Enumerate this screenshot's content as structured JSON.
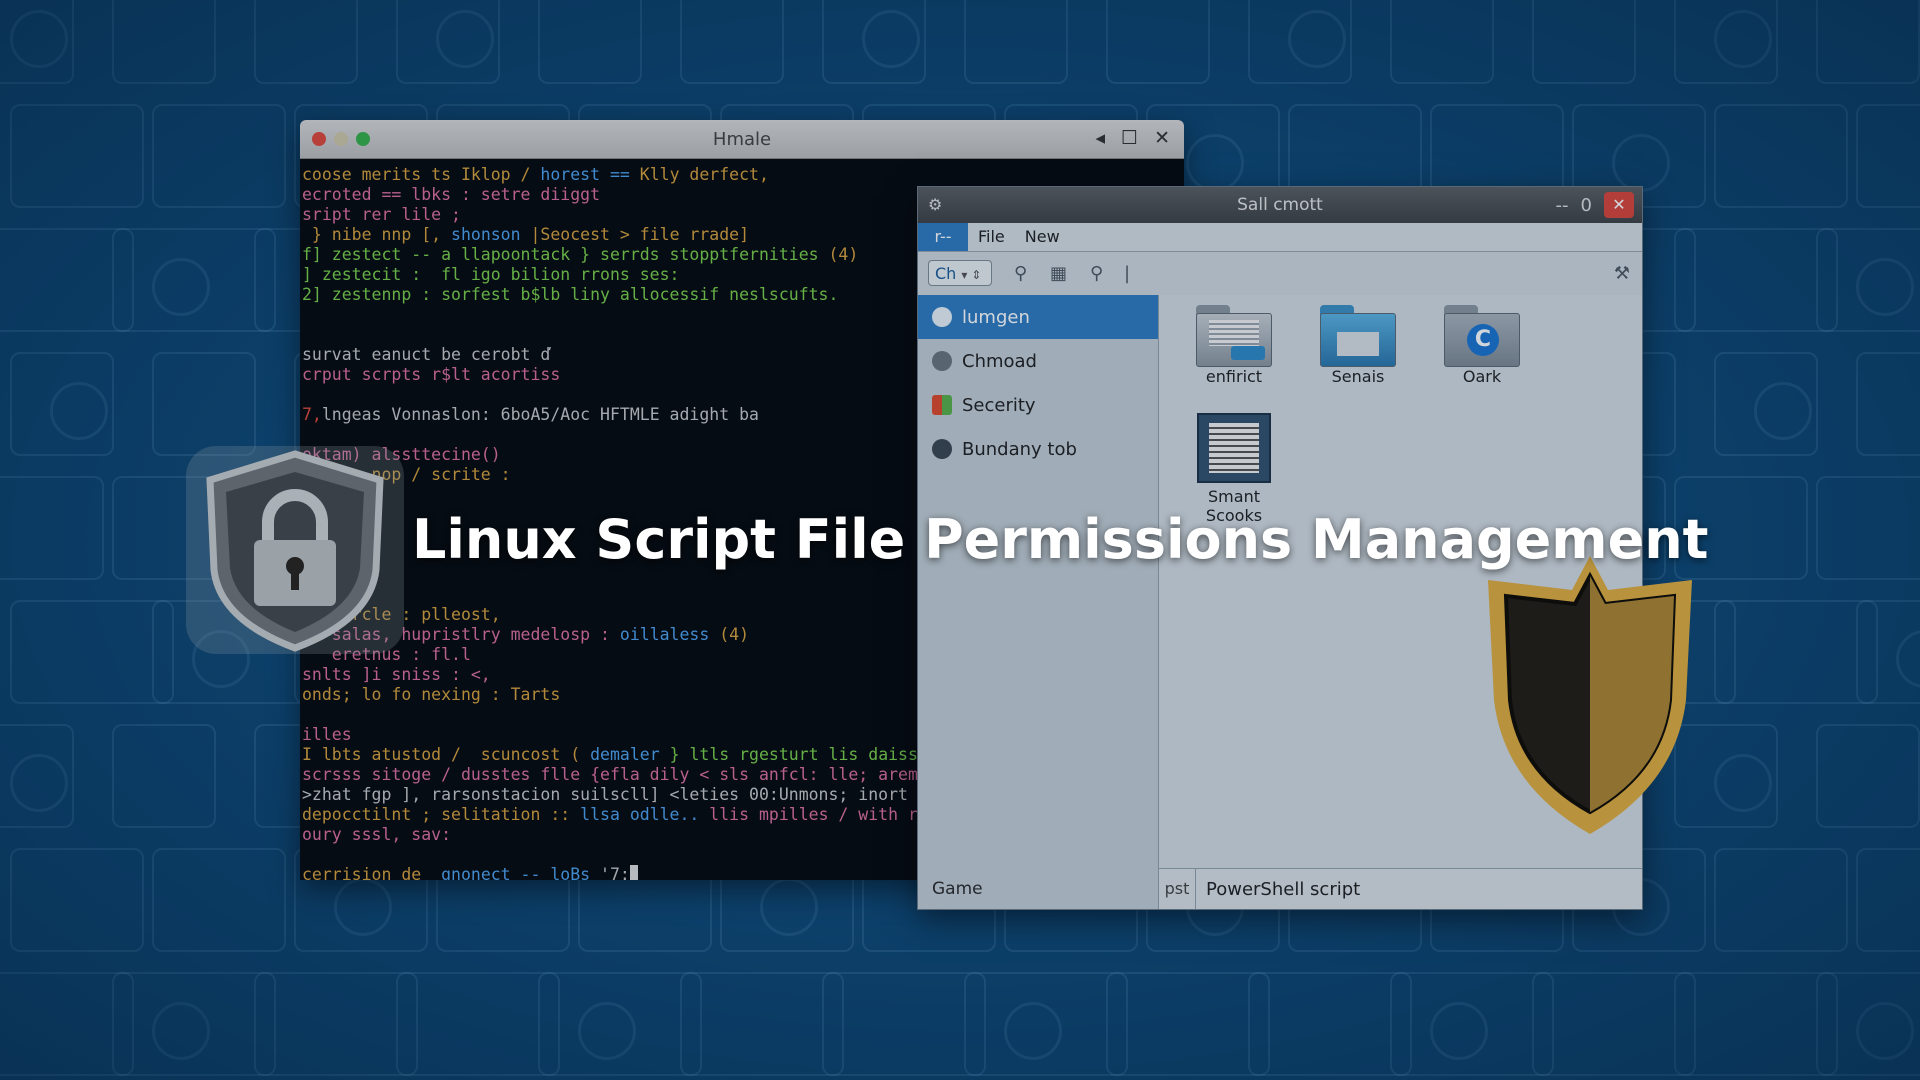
{
  "terminal": {
    "title": "Hmale",
    "lines": [
      [
        {
          "t": "coose merits ts Iklop / ",
          "c": "c-yel"
        },
        {
          "t": "horest == ",
          "c": "c-blu"
        },
        {
          "t": "Klly derfect,",
          "c": "c-yel"
        }
      ],
      [
        {
          "t": "ecroted == lbks : setre diiggt",
          "c": "c-pnk"
        }
      ],
      [
        {
          "t": "sript rer lile ;",
          "c": "c-pnk"
        }
      ],
      [
        {
          "t": " } nibe nnp [, ",
          "c": "c-yel"
        },
        {
          "t": "shonson ",
          "c": "c-blu"
        },
        {
          "t": "|Seocest > file rrade]",
          "c": "c-yel"
        }
      ],
      [
        {
          "t": "f] zestect -- a llapoontack } serrds stopptfernities ",
          "c": "c-grn"
        },
        {
          "t": "(4)",
          "c": "c-yel"
        }
      ],
      [
        {
          "t": "] zestecit :  fl igo bilion rrons ses:",
          "c": "c-grn"
        }
      ],
      [
        {
          "t": "2] zestennp : sorfest b$lb liny allocessif neslscufts.",
          "c": "c-grn"
        }
      ],
      [],
      [],
      [
        {
          "t": "survat eanuct be cerobt ď",
          "c": "c-wht"
        }
      ],
      [
        {
          "t": "crput scrpts r$lt acortiss",
          "c": "c-pnk"
        }
      ],
      [],
      [
        {
          "t": "7,",
          "c": "c-red"
        },
        {
          "t": "lngeas Vonnaslon: 6boA5/Aoc HFTMLE adight ba",
          "c": "c-wht"
        }
      ],
      [],
      [
        {
          "t": "oktam) alssttecine()",
          "c": "c-pnk"
        }
      ],
      [
        {
          "t": "   ... nop / scrite :",
          "c": "c-yel"
        }
      ],
      [],
      [],
      [],
      [],
      [],
      [],
      [
        {
          "t": "   srrcle : plleost,",
          "c": "c-yel"
        }
      ],
      [
        {
          "t": "   salas, hupristlry medelosp : ",
          "c": "c-pnk"
        },
        {
          "t": "oillaless ",
          "c": "c-blu"
        },
        {
          "t": "(4)",
          "c": "c-yel"
        }
      ],
      [
        {
          "t": "   eretnus : fl.l",
          "c": "c-pnk"
        }
      ],
      [
        {
          "t": "snlts ]i sniss : <,",
          "c": "c-pnk"
        }
      ],
      [
        {
          "t": "onds; lo fo nexing : Tarts",
          "c": "c-yel"
        }
      ],
      [],
      [
        {
          "t": "illes",
          "c": "c-pnk"
        }
      ],
      [
        {
          "t": "I lbts atustod /  scuncost ( ",
          "c": "c-yel"
        },
        {
          "t": "demaler ",
          "c": "c-blu"
        },
        {
          "t": "} ltls rgesturt lis daiss",
          "c": "c-grn"
        }
      ],
      [
        {
          "t": "scrsss sitoge / dusstes flle {efla dily < sls anfcl: lle; arem",
          "c": "c-pnk"
        }
      ],
      [
        {
          "t": ">zhat fgp ], rarsonstacion suilscll] <leties 00:Unmons; inort",
          "c": "c-wht"
        }
      ],
      [
        {
          "t": "depocctilnt ; selitation :: ",
          "c": "c-yel"
        },
        {
          "t": "llsa odlle.. ",
          "c": "c-blu"
        },
        {
          "t": "llis mpilles / with rot",
          "c": "c-pnk"
        }
      ],
      [
        {
          "t": "oury sssl, sav:",
          "c": "c-pnk"
        }
      ],
      [],
      [
        {
          "t": "cerrision de  ",
          "c": "c-yel"
        },
        {
          "t": "gnonect -- loBs ",
          "c": "c-blu"
        },
        {
          "t": "'7:",
          "c": "c-wht"
        }
      ]
    ]
  },
  "file_manager": {
    "title": "Sall cmott",
    "ctrl_min": "--",
    "ctrl_max": "0",
    "ctrl_close": "✕",
    "menu": [
      "r-->",
      "File",
      "New"
    ],
    "location": "Ch",
    "sidebar": [
      {
        "label": "lumgen",
        "color": "#e8f1f8"
      },
      {
        "label": "Chmoad",
        "color": "#6b747c"
      },
      {
        "label": "Secerity",
        "color": "#e0a33a"
      },
      {
        "label": "Bundany tob",
        "color": "#3b4650"
      }
    ],
    "sidebar_footer": "Game",
    "files": [
      {
        "label": "enfirict"
      },
      {
        "label": "Senais"
      },
      {
        "label": "Oark"
      },
      {
        "label": "Smant Scooks"
      }
    ],
    "status_prefix": "pst",
    "status_text": "PowerShell script"
  },
  "headline": "Linux Script File Permissions Management",
  "colors": {
    "background": "#0f4a78",
    "accent": "#2f7cc0",
    "shield_gold": "#b8923c"
  }
}
